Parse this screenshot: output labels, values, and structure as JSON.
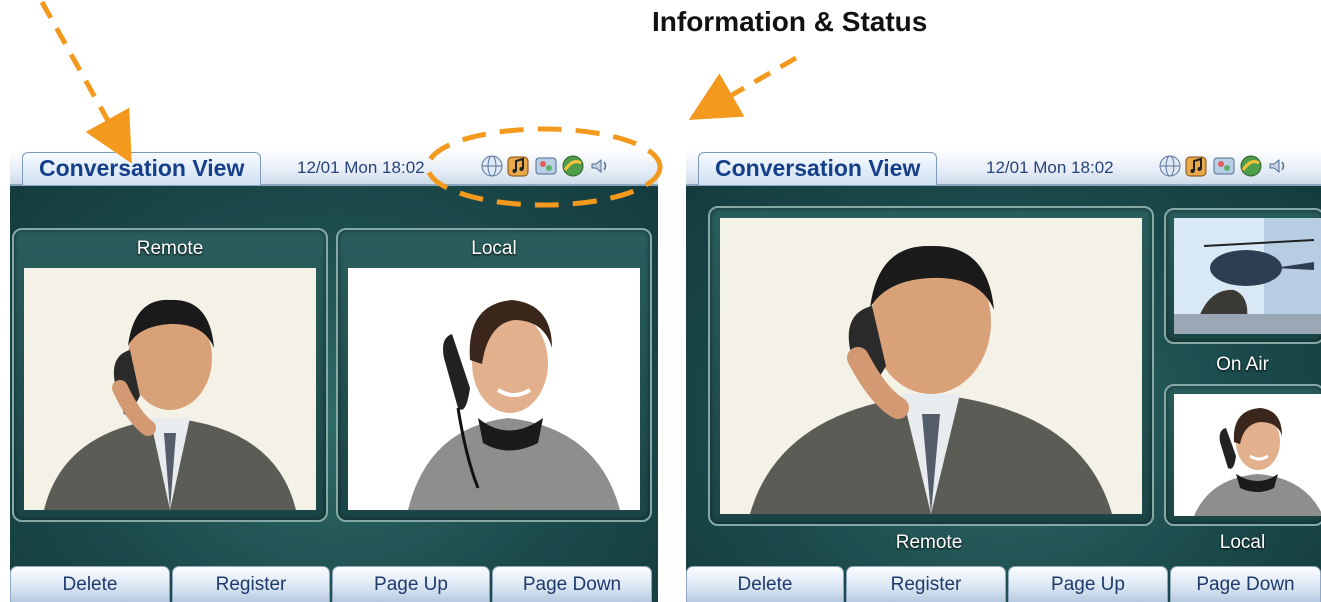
{
  "annotation": {
    "title": "Information & Status"
  },
  "screen_a": {
    "title": "Conversation View",
    "datetime": "12/01 Mon 18:02",
    "status_icons": [
      "globe-icon",
      "music-icon",
      "media-icon",
      "network-icon",
      "speaker-icon"
    ],
    "panels": {
      "remote_label": "Remote",
      "local_label": "Local"
    },
    "buttons": [
      "Delete",
      "Register",
      "Page Up",
      "Page Down"
    ]
  },
  "screen_b": {
    "title": "Conversation View",
    "datetime": "12/01 Mon 18:02",
    "status_icons": [
      "globe-icon",
      "music-icon",
      "media-icon",
      "network-icon",
      "speaker-icon"
    ],
    "labels": {
      "main": "Remote",
      "on_air": "On Air",
      "local": "Local"
    },
    "buttons": [
      "Delete",
      "Register",
      "Page Up",
      "Page Down"
    ]
  },
  "colors": {
    "annotation": "#f39a1e",
    "screen_bg": "#1f4d4e",
    "title_text": "#163f8a"
  }
}
